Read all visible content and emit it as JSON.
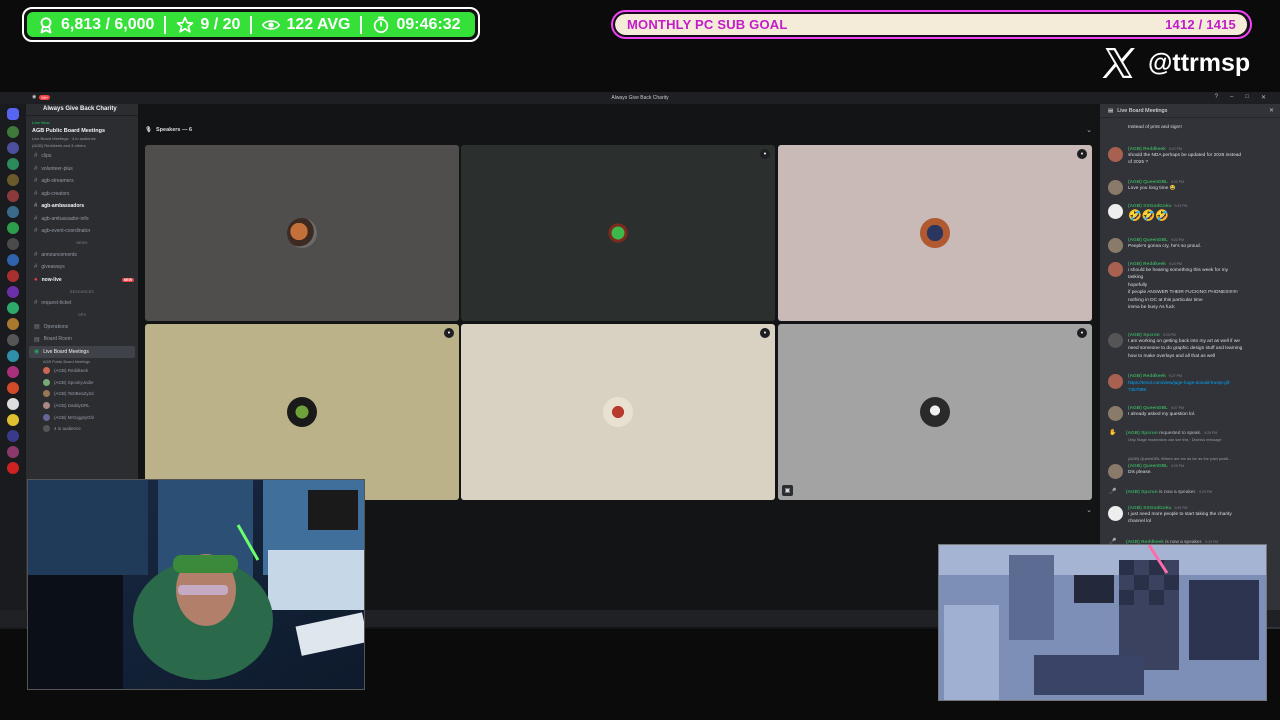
{
  "stats_bar": {
    "followers": "6,813 / 6,000",
    "subs": "9 / 20",
    "viewers": "122 AVG",
    "uptime": "09:46:32"
  },
  "goal": {
    "label": "MONTHLY PC SUB GOAL",
    "current": 1412,
    "target": 1415,
    "value_text": "1412 / 1415",
    "progress": 0.998
  },
  "social": {
    "platform_icon": "x-logo-icon",
    "handle": "@ttrmsp"
  },
  "colors": {
    "stats_green": "#35e038",
    "goal_magenta": "#f043f4",
    "goal_text": "#c21bc9",
    "discord_green": "#3ba55d"
  },
  "discord": {
    "titlebar": {
      "title": "Always Give Back Charity",
      "badge": "99+"
    },
    "server": {
      "name": "Always Give Back Charity",
      "live_tag": "Live Now",
      "live_title": "AGB Public Board Meetings",
      "live_sub1": "Live Board Meetings · 4 in audience",
      "live_sub2": "(AGB) Reddkeek and 3 others"
    },
    "channels": [
      {
        "name": "clips"
      },
      {
        "name": "volunteer-plus"
      },
      {
        "name": "agb-streamers"
      },
      {
        "name": "agb-creators"
      },
      {
        "name": "agb-ambassadors"
      },
      {
        "name": "agb-ambassador-info"
      },
      {
        "name": "agb-event-coordinator"
      }
    ],
    "category_news": "NEWS",
    "news_channels": [
      {
        "name": "announcements"
      },
      {
        "name": "giveaways"
      },
      {
        "name": "now-live",
        "badge": "NEW"
      }
    ],
    "category_resources": "RESOURCES",
    "resource_channels": [
      {
        "name": "request-ticket"
      }
    ],
    "category_ops": "OPS",
    "ops_channels": [
      {
        "name": "Operations"
      },
      {
        "name": "Board Room"
      }
    ],
    "voice_channel": {
      "name": "Live Board Meetings",
      "sub": "AGB Public Board Meetings"
    },
    "members": [
      {
        "name": "(AGB) Reddkeek"
      },
      {
        "name": "(AGB) SpookyJodie"
      },
      {
        "name": "(AGB) TeDBeaZy2d"
      },
      {
        "name": "(AGB) DaddyDRL"
      },
      {
        "name": "(AGB) MrGiggityGhl"
      }
    ],
    "audience": "4 in audience",
    "stage": {
      "speakers_label": "Speakers — 6"
    },
    "chat": {
      "title": "Live Board Meetings",
      "messages": [
        {
          "text": "Instead of print and sign!!"
        },
        {
          "name": "(AGB) Reddkeek",
          "time": "9:22 PM",
          "lines": [
            "should the NDA perhaps be updated for 2026 instead",
            "of 2025 ?"
          ]
        },
        {
          "name": "(AGB) QueenDBL",
          "time": "9:22 PM",
          "lines": [
            "Love you long time 😂"
          ]
        },
        {
          "name": "(AGB) SSGodGoku",
          "time": "9:23 PM",
          "lines": [
            "🤣🤣🤣"
          ]
        },
        {
          "name": "(AGB) QueenDBL",
          "time": "9:23 PM",
          "lines": [
            "Peeple's gonna cry, he's so proud."
          ]
        },
        {
          "name": "(AGB) Reddkeek",
          "time": "9:24 PM",
          "lines": [
            "i should be hearing something this week for my",
            "tasking",
            "hopefully",
            "if people ANSWER THEIR FUCKING PHONES!!!!!!!",
            "nothing in DC at this particular time",
            "imma be busy As fuck"
          ]
        },
        {
          "name": "(AGB) Spcron",
          "time": "9:25 PM",
          "lines": [
            "I am working on getting back into my art as well if we",
            "need someone to do graphic design stuff and learning",
            "how to make overlays and all that as well"
          ]
        },
        {
          "name": "(AGB) Reddkeek",
          "time": "9:27 PM",
          "link": [
            "https://tenor.com/view/juge-huge-donald-trump-gif-",
            "7357998"
          ]
        },
        {
          "name": "(AGB) QueenDBL",
          "time": "9:27 PM",
          "lines": [
            "I already asked my question lol."
          ]
        }
      ],
      "request_speak": {
        "name": "(AGB) Spcron",
        "text": "requested to speak.",
        "time": "9:28 PM",
        "sub": "Only Stage moderators can see this · Dismiss message"
      },
      "reply_line": "(AGB) QueenDBL Where are we as far as the paid positi...",
      "reply_msg": {
        "name": "(AGB) QueenDBL",
        "time": "9:29 PM",
        "text": "Dis please."
      },
      "speaker1": {
        "name": "(AGB) Spcron",
        "text": "is now a speaker.",
        "time": "9:29 PM"
      },
      "msg_godgoku": {
        "name": "(AGB) SSGodGoku",
        "time": "9:29 PM",
        "lines": [
          "I just need more people to start taking the charity",
          "channel lol"
        ]
      },
      "speaker2": {
        "name": "(AGB) Reddkeek",
        "text": "is now a speaker.",
        "time": "9:29 PM"
      }
    }
  },
  "icons": {
    "followers": "person-icon",
    "subs": "star-icon",
    "viewers": "eye-icon",
    "uptime": "stopwatch-icon"
  }
}
